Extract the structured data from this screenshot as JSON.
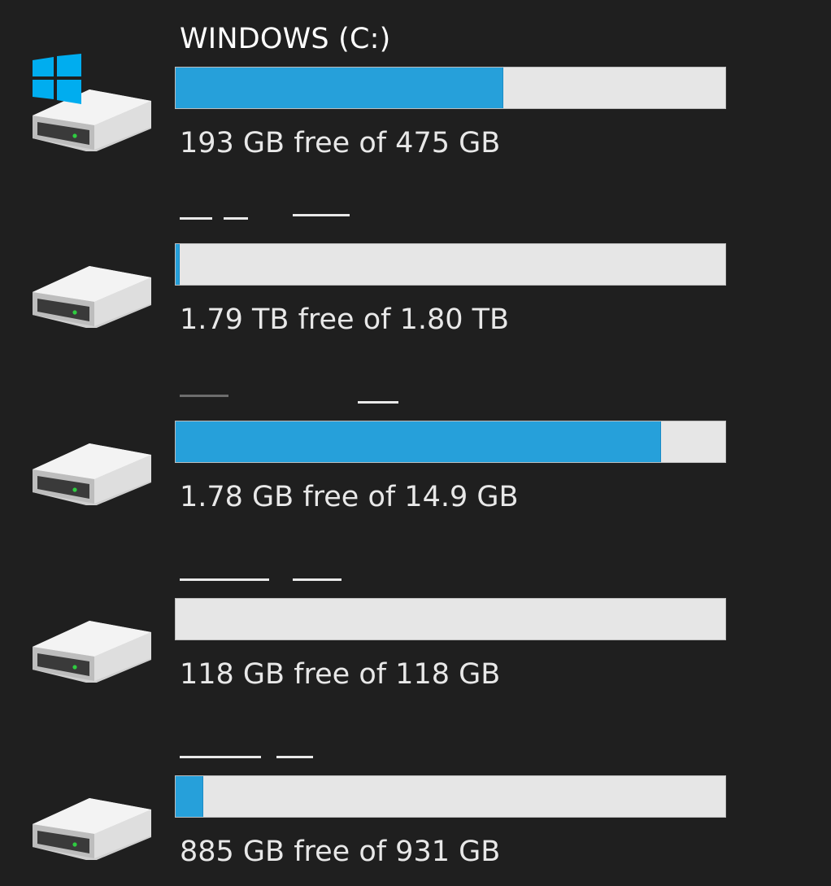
{
  "drives": [
    {
      "name": "WINDOWS (C:)",
      "name_redacted": false,
      "is_system": true,
      "used_fraction": 0.594,
      "free_text": "193 GB free of 475 GB"
    },
    {
      "name": "",
      "name_redacted": true,
      "is_system": false,
      "used_fraction": 0.006,
      "free_text": "1.79 TB free of 1.80 TB"
    },
    {
      "name": "",
      "name_redacted": true,
      "is_system": false,
      "used_fraction": 0.881,
      "free_text": "1.78 GB free of 14.9 GB"
    },
    {
      "name": "",
      "name_redacted": true,
      "is_system": false,
      "used_fraction": 0.0,
      "free_text": "118 GB free of 118 GB"
    },
    {
      "name": "",
      "name_redacted": true,
      "is_system": false,
      "used_fraction": 0.049,
      "free_text": "885 GB free of 931 GB"
    }
  ],
  "icons": {
    "drive": "hard-drive-icon",
    "system": "windows-logo-icon"
  },
  "colors": {
    "background": "#1f1f1f",
    "bar_fill": "#26a0da",
    "bar_track": "#e6e6e6",
    "windows_logo": "#00adef"
  }
}
